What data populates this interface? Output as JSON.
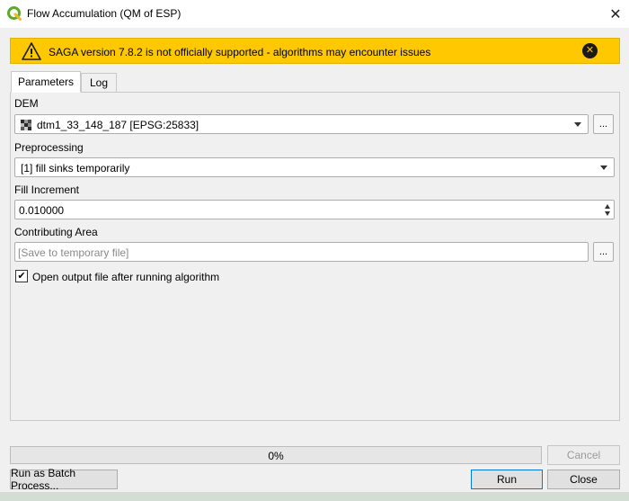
{
  "window": {
    "title": "Flow Accumulation (QM of ESP)",
    "close_glyph": "✕",
    "app_icon": "qgis-logo-icon"
  },
  "warning": {
    "text": "SAGA version 7.8.2 is not officially supported - algorithms may encounter issues",
    "icon": "warning-triangle-icon",
    "close_glyph": "✕",
    "background": "#ffc800"
  },
  "tabs": [
    {
      "label": "Parameters",
      "active": true
    },
    {
      "label": "Log",
      "active": false
    }
  ],
  "params": {
    "dem": {
      "label": "DEM",
      "value": "dtm1_33_148_187 [EPSG:25833]",
      "browse_label": "..."
    },
    "preprocessing": {
      "label": "Preprocessing",
      "value": "[1] fill sinks temporarily"
    },
    "fill_increment": {
      "label": "Fill Increment",
      "value": "0.010000"
    },
    "contributing_area": {
      "label": "Contributing Area",
      "placeholder": "[Save to temporary file]",
      "browse_label": "..."
    },
    "open_output": {
      "label": "Open output file after running algorithm",
      "checked": true,
      "check_glyph": "✔"
    }
  },
  "progress": {
    "value": 0,
    "text": "0%"
  },
  "buttons": {
    "cancel": "Cancel",
    "batch": "Run as Batch Process...",
    "run": "Run",
    "close": "Close"
  },
  "colors": {
    "accent_focus": "#0078d7",
    "dialog_bg": "#f0f0f0"
  }
}
